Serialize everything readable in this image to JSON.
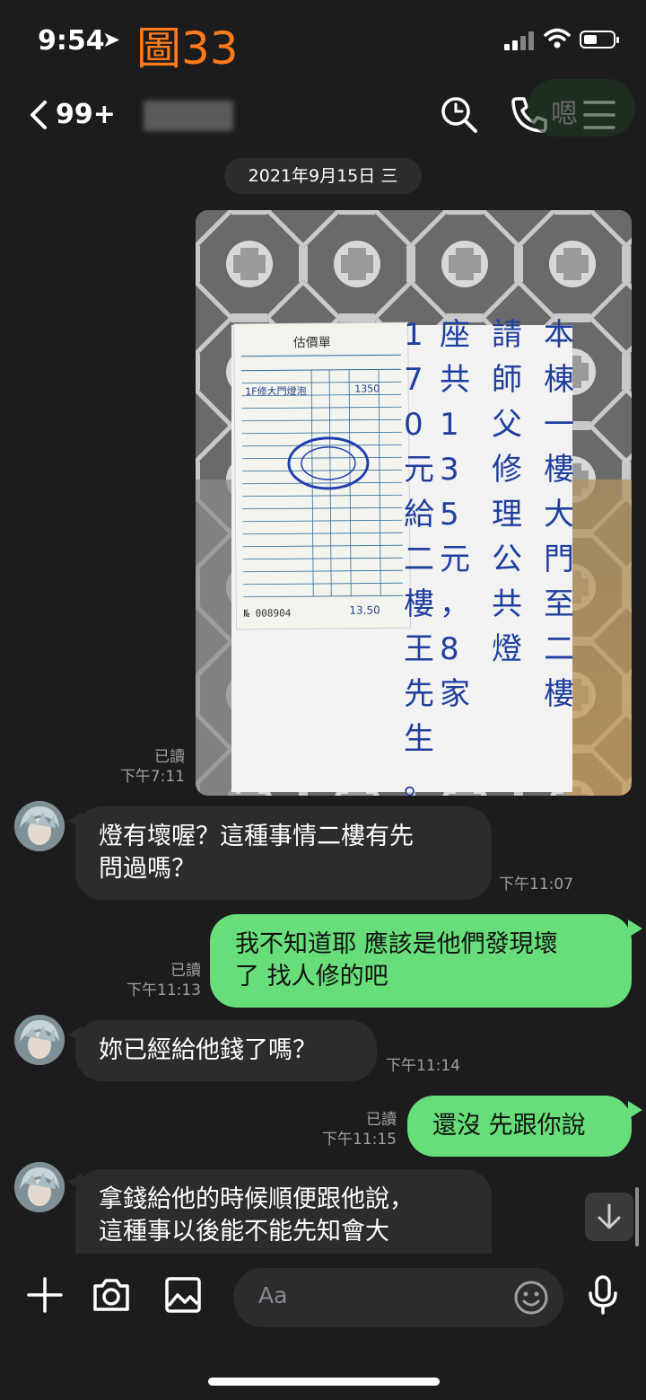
{
  "status_bar": {
    "time": "9:54",
    "battery_level": 0.45
  },
  "figure_label": "圖33",
  "header": {
    "unread_count": "99+",
    "peek_text": "嗯"
  },
  "date_separator": "2021年9月15日 三",
  "photo_message": {
    "read_label": "已讀",
    "time": "下午7:11",
    "receipt": {
      "title": "估價單",
      "serial_no": "№ 008904",
      "item": "1F修大門燈泡",
      "amount": "1350",
      "total": "13.50"
    },
    "notice_columns": [
      "本棟一樓大門至二樓",
      "請師父修理公共燈",
      "座共135元，8家",
      "170元給二樓王先生。"
    ]
  },
  "messages": [
    {
      "id": "m1",
      "direction": "in",
      "text": [
        "燈有壞喔？這種事情二樓有先",
        "問過嗎？"
      ],
      "time": "下午11:07"
    },
    {
      "id": "m2",
      "direction": "out",
      "text": [
        "我不知道耶 應該是他們發現壞",
        "了 找人修的吧"
      ],
      "read_label": "已讀",
      "time": "下午11:13"
    },
    {
      "id": "m3",
      "direction": "in",
      "text": [
        "妳已經給他錢了嗎？"
      ],
      "time": "下午11:14"
    },
    {
      "id": "m4",
      "direction": "out",
      "text": [
        "還沒 先跟你說"
      ],
      "read_label": "已讀",
      "time": "下午11:15"
    },
    {
      "id": "m5",
      "direction": "in",
      "text": [
        "拿錢給他的時候順便跟他說，",
        "這種事以後能不能先知會大"
      ]
    }
  ],
  "input_bar": {
    "placeholder": "Aa"
  },
  "icons": {
    "back": "chevron-left-icon",
    "search": "search-icon",
    "call": "phone-icon",
    "menu": "menu-icon",
    "add": "plus-icon",
    "camera": "camera-icon",
    "gallery": "image-icon",
    "emoji": "emoji-icon",
    "mic": "microphone-icon",
    "scroll": "arrow-down-icon"
  },
  "colors": {
    "background": "#1c1c1e",
    "incoming_bubble": "#2c2c2e",
    "outgoing_bubble": "#67de7a",
    "figure_label": "#ff7a1a"
  }
}
